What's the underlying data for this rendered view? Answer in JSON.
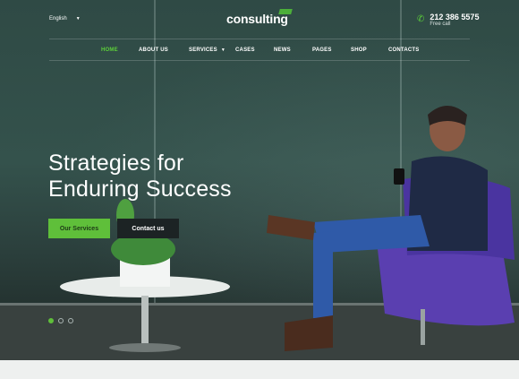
{
  "header": {
    "language": "English",
    "logo_text": "consulting",
    "phone_number": "212 386 5575",
    "phone_caption": "Free call"
  },
  "nav": {
    "items": [
      {
        "label": "HOME",
        "active": true
      },
      {
        "label": "ABOUT US"
      },
      {
        "label": "SERVICES",
        "has_submenu": true
      },
      {
        "label": "CASES"
      },
      {
        "label": "NEWS"
      },
      {
        "label": "PAGES"
      },
      {
        "label": "SHOP"
      },
      {
        "label": "CONTACTS"
      }
    ]
  },
  "hero": {
    "headline_line1": "Strategies for",
    "headline_line2": "Enduring Success",
    "primary_button": "Our Services",
    "secondary_button": "Contact us",
    "slides": 3,
    "active_slide": 1
  },
  "colors": {
    "accent": "#5fbf3a",
    "dark_button": "#1c2324",
    "chair": "#5a3fb0"
  }
}
